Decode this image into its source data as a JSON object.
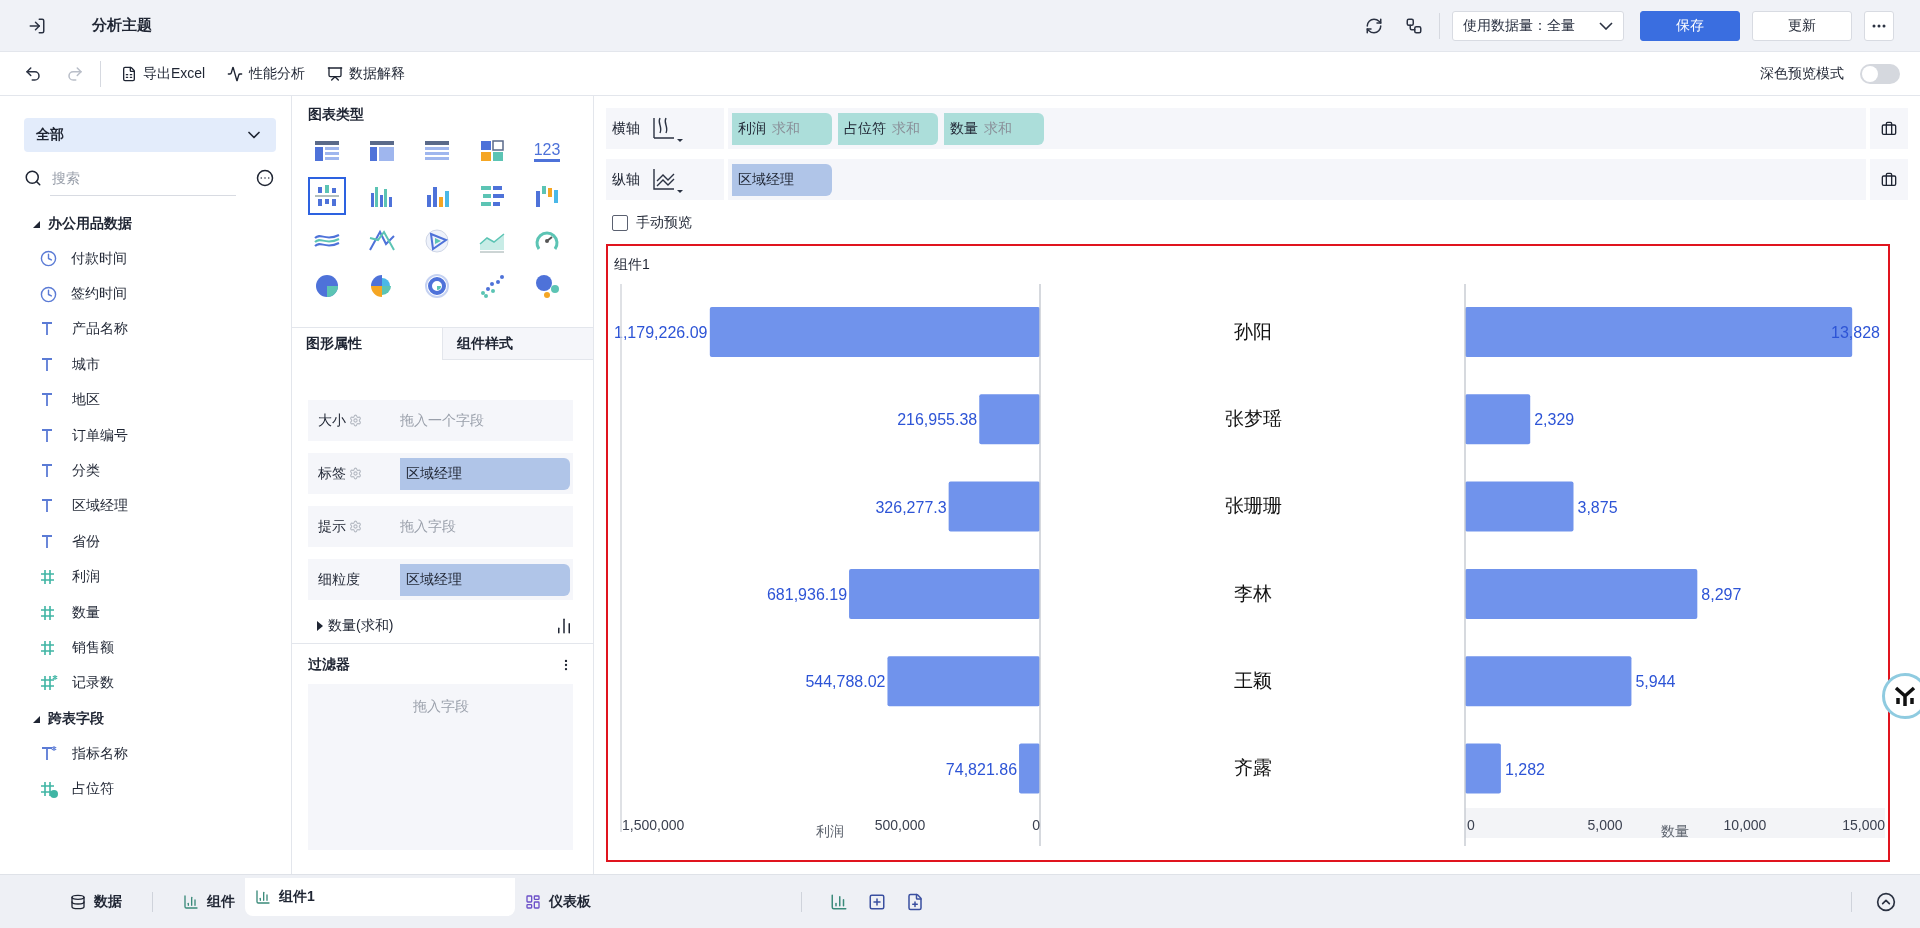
{
  "header": {
    "title": "分析主题",
    "data_select": "使用数据量：全量",
    "buttons": [
      {
        "label": "保存",
        "kind": "primary"
      },
      {
        "label": "更新",
        "kind": "default"
      }
    ]
  },
  "toolbar": {
    "actions": [
      {
        "label": "导出Excel",
        "kind": "excel"
      },
      {
        "label": "性能分析",
        "kind": "performance"
      },
      {
        "label": "数据解释",
        "kind": "explain"
      }
    ],
    "dark_preview": {
      "label": "深色预览模式",
      "on": false
    }
  },
  "data_panel": {
    "scope": "全部",
    "search": {
      "placeholder": "搜索"
    },
    "groups": [
      {
        "label": "办公用品数据",
        "expanded": true,
        "children": [
          {
            "label": "付款时间",
            "kind": "date"
          },
          {
            "label": "签约时间",
            "kind": "date"
          },
          {
            "label": "产品名称",
            "kind": "text"
          },
          {
            "label": "城市",
            "kind": "text"
          },
          {
            "label": "地区",
            "kind": "text"
          },
          {
            "label": "订单编号",
            "kind": "text"
          },
          {
            "label": "分类",
            "kind": "text"
          },
          {
            "label": "区域经理",
            "kind": "text"
          },
          {
            "label": "省份",
            "kind": "text"
          },
          {
            "label": "利润",
            "kind": "number"
          },
          {
            "label": "数量",
            "kind": "number"
          },
          {
            "label": "销售额",
            "kind": "number"
          },
          {
            "label": "记录数",
            "kind": "calc-number"
          }
        ]
      },
      {
        "label": "跨表字段",
        "expanded": true,
        "children": [
          {
            "label": "指标名称",
            "kind": "calc-text"
          },
          {
            "label": "占位符",
            "kind": "param"
          }
        ]
      }
    ]
  },
  "chart_panel": {
    "title": "图表类型",
    "types": [
      {
        "kind": "table",
        "selected": false
      },
      {
        "kind": "crosstable",
        "selected": false
      },
      {
        "kind": "detail",
        "selected": false
      },
      {
        "kind": "blocks",
        "selected": false
      },
      {
        "kind": "number",
        "label": "123",
        "selected": false
      },
      {
        "kind": "groupbar",
        "selected": true
      },
      {
        "kind": "multibar",
        "selected": false
      },
      {
        "kind": "colorbar",
        "selected": false
      },
      {
        "kind": "hbar",
        "selected": false
      },
      {
        "kind": "waterfall",
        "selected": false
      },
      {
        "kind": "line",
        "selected": false
      },
      {
        "kind": "polyline",
        "selected": false
      },
      {
        "kind": "radar",
        "selected": false
      },
      {
        "kind": "area",
        "selected": false
      },
      {
        "kind": "gauge",
        "selected": false
      },
      {
        "kind": "pie",
        "selected": false
      },
      {
        "kind": "rose",
        "selected": false
      },
      {
        "kind": "ring",
        "selected": false
      },
      {
        "kind": "scatter",
        "selected": false
      },
      {
        "kind": "bubble",
        "selected": false
      }
    ]
  },
  "properties": {
    "tabs": [
      {
        "label": "图形属性",
        "selected": true
      },
      {
        "label": "组件样式",
        "selected": false
      }
    ],
    "fields": [
      {
        "label": "大小",
        "settings": true,
        "placeholder": "拖入一个字段"
      },
      {
        "label": "标签",
        "settings": true,
        "value": "区域经理"
      },
      {
        "label": "提示",
        "settings": true,
        "placeholder": "拖入字段"
      },
      {
        "label": "细粒度",
        "settings": false,
        "value": "区域经理"
      }
    ],
    "measure": {
      "label": "数量(求和)",
      "expanded": false
    }
  },
  "filter": {
    "title": "过滤器",
    "placeholder": "拖入字段"
  },
  "axes": [
    {
      "label": "横轴",
      "fields": [
        {
          "name": "利润",
          "agg": "求和",
          "kind": "measure"
        },
        {
          "name": "占位符",
          "agg": "求和",
          "kind": "measure"
        },
        {
          "name": "数量",
          "agg": "求和",
          "kind": "measure"
        }
      ]
    },
    {
      "label": "纵轴",
      "fields": [
        {
          "name": "区域经理",
          "kind": "dimension"
        }
      ]
    }
  ],
  "manual_preview": {
    "label": "手动预览",
    "checked": false
  },
  "component": {
    "title": "组件1",
    "categories": [
      "孙阳",
      "张梦瑶",
      "张珊珊",
      "李林",
      "王颖",
      "齐露"
    ],
    "charts": [
      {
        "chart_data": {
          "type": "bar",
          "orientation": "horizontal",
          "xlabel": "利润",
          "values": [
            1179226.09,
            216955.38,
            326277.3,
            681936.19,
            544788.02,
            74821.86
          ],
          "value_labels": [
            "1,179,226.09",
            "216,955.38",
            "326,277.3",
            "681,936.19",
            "544,788.02",
            "74,821.86"
          ],
          "xlim": [
            1500000,
            0
          ],
          "xticks": [
            {
              "value": 1500000,
              "label": "1,500,000"
            },
            {
              "value": 500000,
              "label": "500,000"
            },
            {
              "value": 0,
              "label": "0"
            }
          ]
        }
      },
      {
        "chart_data": {
          "type": "bar",
          "orientation": "horizontal",
          "xlabel": "数量",
          "values": [
            13828,
            2329,
            3875,
            8297,
            5944,
            1282
          ],
          "value_labels": [
            "13,828",
            "2,329",
            "3,875",
            "8,297",
            "5,944",
            "1,282"
          ],
          "xlim": [
            0,
            15000
          ],
          "xticks": [
            {
              "value": 0,
              "label": "0"
            },
            {
              "value": 5000,
              "label": "5,000"
            },
            {
              "value": 10000,
              "label": "10,000"
            },
            {
              "value": 15000,
              "label": "15,000"
            }
          ]
        }
      }
    ]
  },
  "bottom_tabs": [
    {
      "label": "数据",
      "kind": "data",
      "selected": false
    },
    {
      "label": "组件",
      "kind": "component",
      "selected": false
    },
    {
      "label": "组件1",
      "kind": "component",
      "selected": true
    },
    {
      "label": "仪表板",
      "kind": "dashboard",
      "selected": false
    }
  ]
}
